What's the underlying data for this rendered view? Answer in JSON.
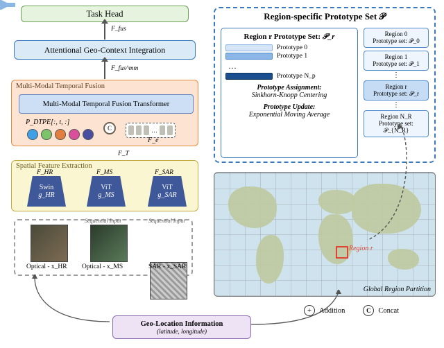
{
  "task_head": {
    "label": "Task Head"
  },
  "flow": {
    "F_fus": "F_fus",
    "F_fus_mm": "F_fus^mm",
    "F_T": "F_T"
  },
  "geo_ctx": {
    "label": "Attentional Geo-Context Integration"
  },
  "mmtf": {
    "title": "Multi-Modal Temporal Fusion",
    "inner": "Multi-Modal Temporal Fusion Transformer",
    "pdtpe": "P_DTPE[:, t, :]",
    "fe": "F_e",
    "circle_colors": [
      "#3fa0e6",
      "#7cc36a",
      "#e07f3f",
      "#d94f9b",
      "#4a4ea0"
    ]
  },
  "sfe": {
    "title": "Spatial Feature Extraction",
    "encoders": [
      {
        "name": "Swin",
        "g": "g_HR",
        "F": "F_HR"
      },
      {
        "name": "ViT",
        "g": "g_MS",
        "F": "F_MS"
      },
      {
        "name": "ViT",
        "g": "g_SAR",
        "F": "F_SAR"
      }
    ]
  },
  "inputs": {
    "seq_tag": "Sequential Input",
    "items": [
      {
        "label": "Optical - x_HR"
      },
      {
        "label": "Optical - x_MS"
      },
      {
        "label": "SAR - x_SAR"
      }
    ]
  },
  "geo_loc": {
    "title": "Geo-Location Information",
    "sub": "(latitude, longitude)"
  },
  "proto": {
    "panel_title": "Region-specific Prototype Set 𝒫",
    "region_hdr_prefix": "Region r Prototype Set: ",
    "region_hdr_sym": "𝒫_r",
    "items": [
      "Prototype 0",
      "Prototype 1",
      "…",
      "Prototype N_p"
    ],
    "assign_title": "Prototype Assignment:",
    "assign_body": "Sinkhorn-Knopp Centering",
    "update_title": "Prototype Update:",
    "update_body": "Exponential Moving Average",
    "regions": {
      "r0": {
        "name": "Region 0",
        "set": "Prototype set: 𝒫_0"
      },
      "r1": {
        "name": "Region 1",
        "set": "Prototype set: 𝒫_1"
      },
      "rr": {
        "name": "Region r",
        "set": "Prototype set: 𝒫_r"
      },
      "rN": {
        "name": "Region N_R",
        "set": "Prototype set: 𝒫_{N_R}"
      }
    }
  },
  "map": {
    "region_label": "Region r",
    "caption": "Global Region Partition"
  },
  "legend": {
    "addition": "Addition",
    "concat": "Concat"
  }
}
